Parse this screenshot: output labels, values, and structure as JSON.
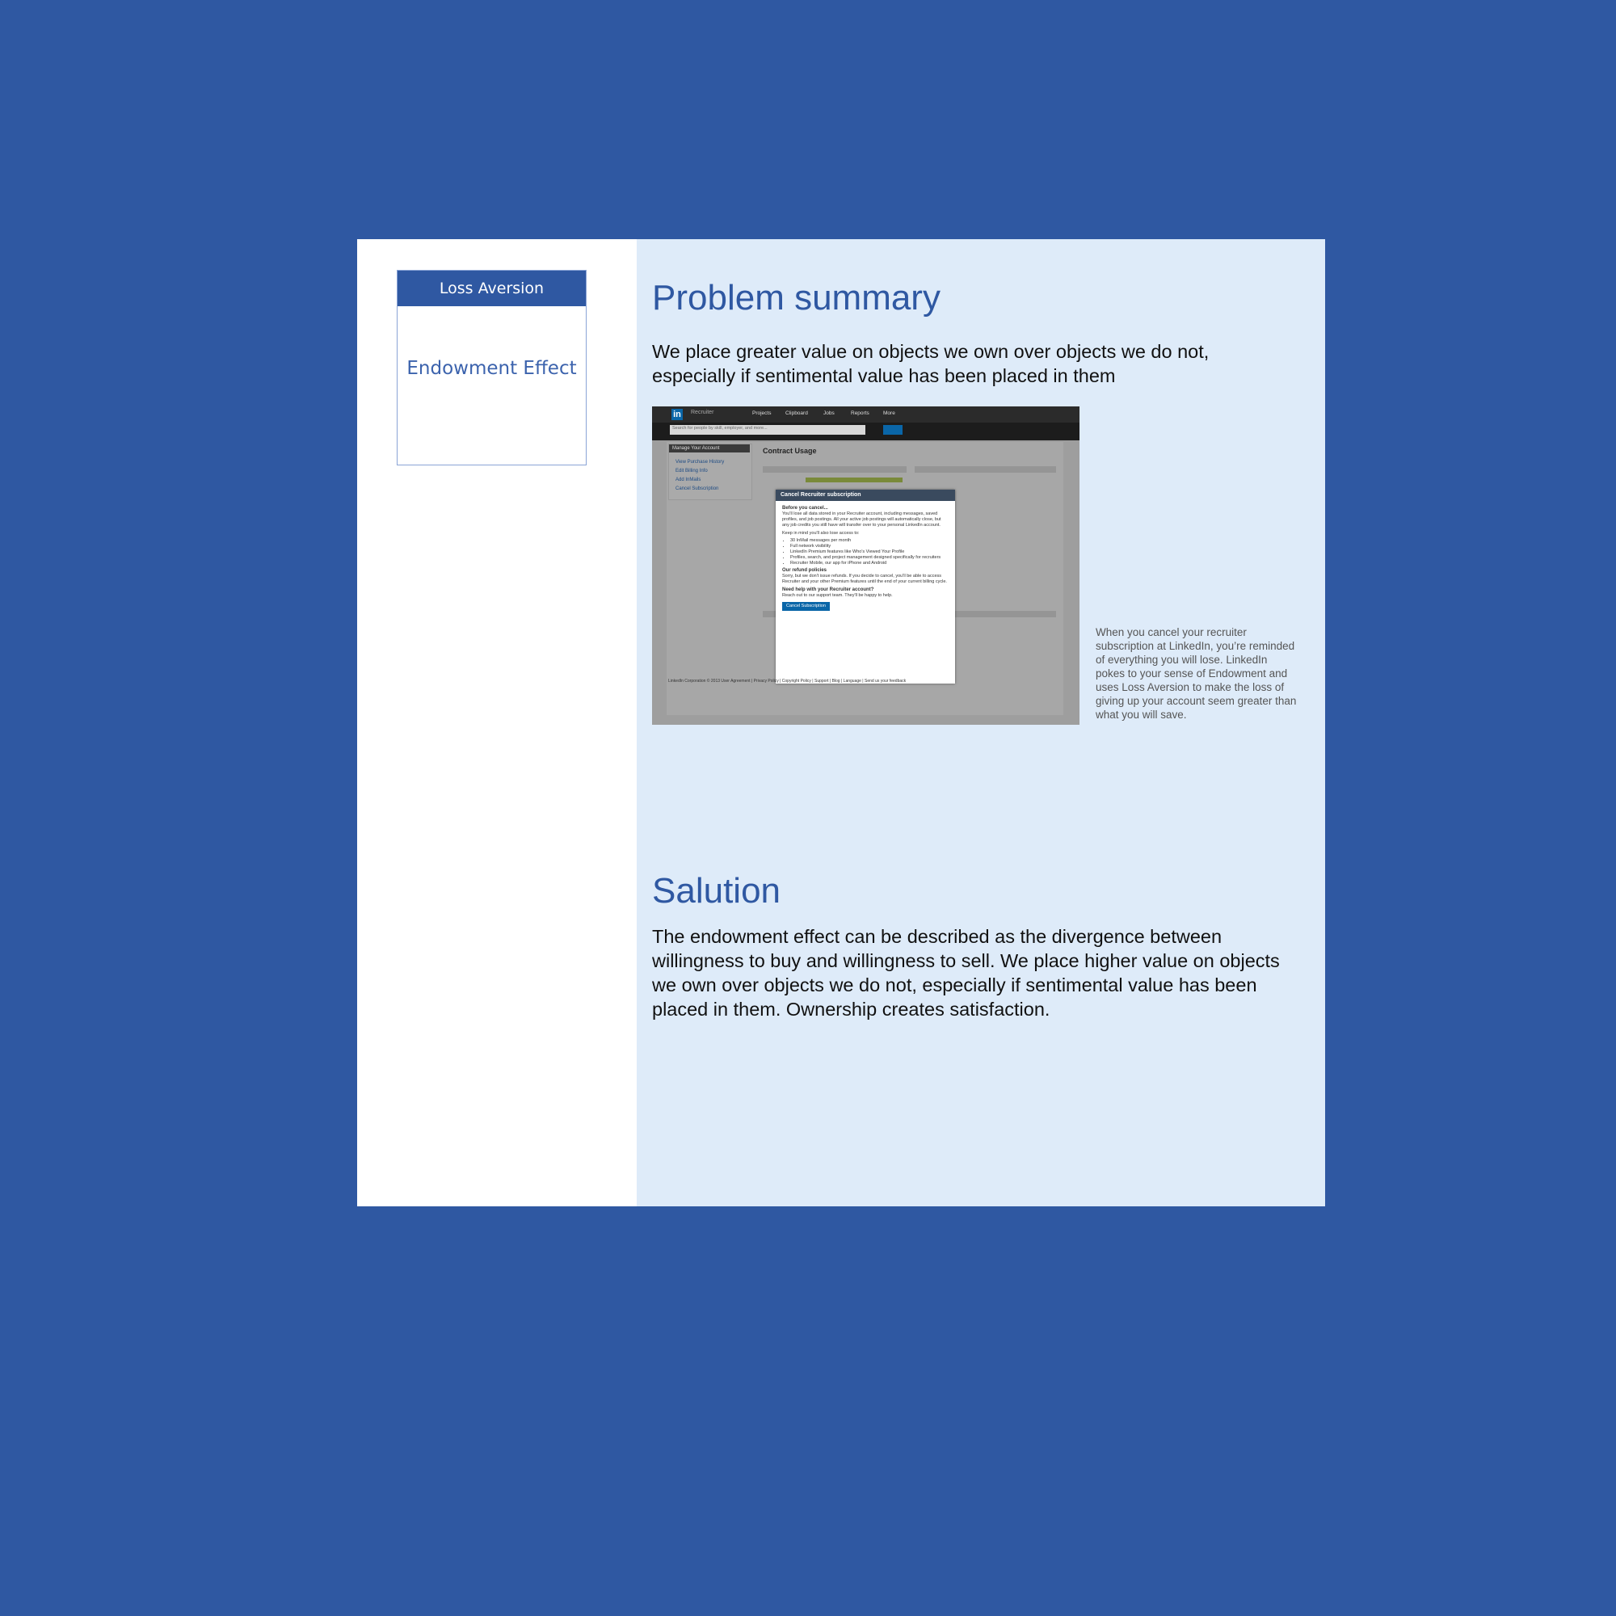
{
  "sidebar": {
    "category_label": "Loss Aversion",
    "topic_label": "Endowment Effect"
  },
  "problem": {
    "heading": "Problem summary",
    "text": "We place greater value on objects we own over objects we do not, especially if sentimental value has been placed in them",
    "caption": "When you cancel your recruiter subscription at LinkedIn, you’re reminded of everything you will lose. LinkedIn pokes to your sense of Endowment and uses Loss Aversion to make the loss of giving up your account seem greater than what you will save."
  },
  "solution": {
    "heading": "Salution",
    "text": "The endowment effect can be described as the divergence between willingness to buy and willingness to sell. We place higher value on objects we own over objects we do not, especially if sentimental value has been placed in them. Ownership creates satisfaction."
  },
  "screenshot": {
    "logo": "in",
    "brand": "Recruiter",
    "nav": [
      "Projects",
      "Clipboard",
      "Jobs",
      "Reports",
      "More"
    ],
    "search_placeholder": "Search for people by skill, employer, and more...",
    "side_head": "Manage Your Account",
    "side_links": [
      "View Purchase History",
      "Edit Billing Info",
      "Add InMails",
      "Cancel Subscription"
    ],
    "main_title": "Contract Usage",
    "modal_title": "Cancel Recruiter subscription",
    "modal_intro_head": "Before you cancel...",
    "modal_intro": "You'll lose all data stored in your Recruiter account, including messages, saved profiles, and job postings. All your active job postings will automatically close, but any job credits you still have will transfer over to your personal LinkedIn account.",
    "modal_keep": "Keep in mind you'll also lose access to:",
    "modal_list": [
      "30 InMail messages per month",
      "Full network visibility",
      "LinkedIn Premium features like Who's Viewed Your Profile",
      "Profiles, search, and project management designed specifically for recruiters",
      "Recruiter Mobile, our app for iPhone and Android"
    ],
    "refund_head": "Our refund policies",
    "refund_text": "Sorry, but we don't issue refunds. If you decide to cancel, you'll be able to access Recruiter and your other Premium features until the end of your current billing cycle.",
    "help_head": "Need help with your Recruiter account?",
    "help_text": "Reach out to our support team. They'll be happy to help.",
    "cancel_button": "Cancel Subscription",
    "footer": "LinkedIn Corporation © 2013  User Agreement | Privacy Policy | Copyright Policy | Support | Blog | Language | Send us your feedback"
  }
}
